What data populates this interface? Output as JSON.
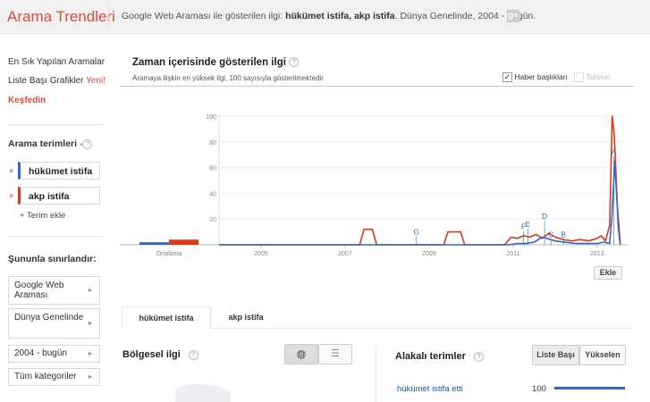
{
  "header": {
    "brand": "Arama Trendleri",
    "subtitle_prefix": "Google Web Araması ile gösterilen ilgi: ",
    "subtitle_terms": "hükümet istifa, akp istifa",
    "subtitle_suffix": ". Dünya Genelinde, 2004 - bugün.",
    "share_icon": "google-plus-icon"
  },
  "sidebar": {
    "top_searches": "En Sık Yapılan Aramalar",
    "top_charts": "Liste Başı Grafikler",
    "new_badge": "Yeni!",
    "explore": "Keşfedin",
    "search_terms_title": "Arama terimleri",
    "terms": [
      {
        "label": "hükümet istifa",
        "color": "#3366cc"
      },
      {
        "label": "akp istifa",
        "color": "#dc3912"
      }
    ],
    "add_term": "+ Terim ekle",
    "limit_title": "Şununla sınırlandır:",
    "filters": [
      "Google Web Araması",
      "Dünya Genelinde",
      "2004 - bugün",
      "Tüm kategoriler"
    ]
  },
  "main": {
    "title": "Zaman içerisinde gösterilen ilgi",
    "subtitle": "Aramaya ilişkin en yüksek ilgi, 100 sayısıyla gösterilmektedir",
    "news_headlines": "Haber başlıkları",
    "forecast": "Tahmin",
    "embed_button": "Ekle",
    "tabs": [
      "hükümet istifa",
      "akp istifa"
    ],
    "regional_title": "Bölgesel ilgi",
    "related_title": "Alakalı terimler",
    "btn_top": "Liste Başı",
    "btn_rising": "Yükselen",
    "related_rows": [
      {
        "term": "hükümet istifa etti",
        "value": "100"
      }
    ]
  },
  "chart_data": {
    "type": "line",
    "average_label": "Ortalama",
    "averages": [
      {
        "name": "hükümet istifa",
        "value": 2
      },
      {
        "name": "akp istifa",
        "value": 4
      }
    ],
    "x_tick_labels": [
      "2005",
      "2007",
      "2009",
      "2011",
      "2013"
    ],
    "y_tick_labels": [
      "20",
      "40",
      "60",
      "80",
      "100"
    ],
    "ylim": [
      0,
      100
    ],
    "xlim": [
      2004.0,
      2013.6
    ],
    "annotations": [
      "G",
      "F",
      "E",
      "D",
      "C",
      "B",
      "A"
    ],
    "series": [
      {
        "name": "hükümet istifa",
        "color": "#3366cc",
        "x": [
          2004.0,
          2010.5,
          2010.9,
          2011.1,
          2011.3,
          2011.5,
          2011.7,
          2012.0,
          2012.5,
          2013.0,
          2013.15,
          2013.3,
          2013.35,
          2013.42,
          2013.48,
          2013.55
        ],
        "y": [
          0,
          0,
          0,
          1,
          1,
          2,
          6,
          3,
          1,
          1,
          2,
          1,
          20,
          65,
          30,
          2
        ]
      },
      {
        "name": "akp istifa",
        "color": "#dc3912",
        "x": [
          2004.0,
          2007.35,
          2007.45,
          2007.65,
          2007.75,
          2009.35,
          2009.45,
          2009.75,
          2009.85,
          2010.8,
          2010.95,
          2011.1,
          2011.25,
          2011.4,
          2011.55,
          2011.7,
          2011.85,
          2012.0,
          2012.2,
          2012.4,
          2012.6,
          2012.8,
          2013.0,
          2013.1,
          2013.2,
          2013.3,
          2013.36,
          2013.41,
          2013.45,
          2013.5,
          2013.55
        ],
        "y": [
          0,
          0,
          12,
          12,
          0,
          0,
          10,
          10,
          0,
          0,
          6,
          5,
          7,
          6,
          8,
          5,
          9,
          6,
          4,
          3,
          4,
          3,
          5,
          7,
          3,
          15,
          100,
          85,
          55,
          15,
          0
        ]
      }
    ]
  }
}
